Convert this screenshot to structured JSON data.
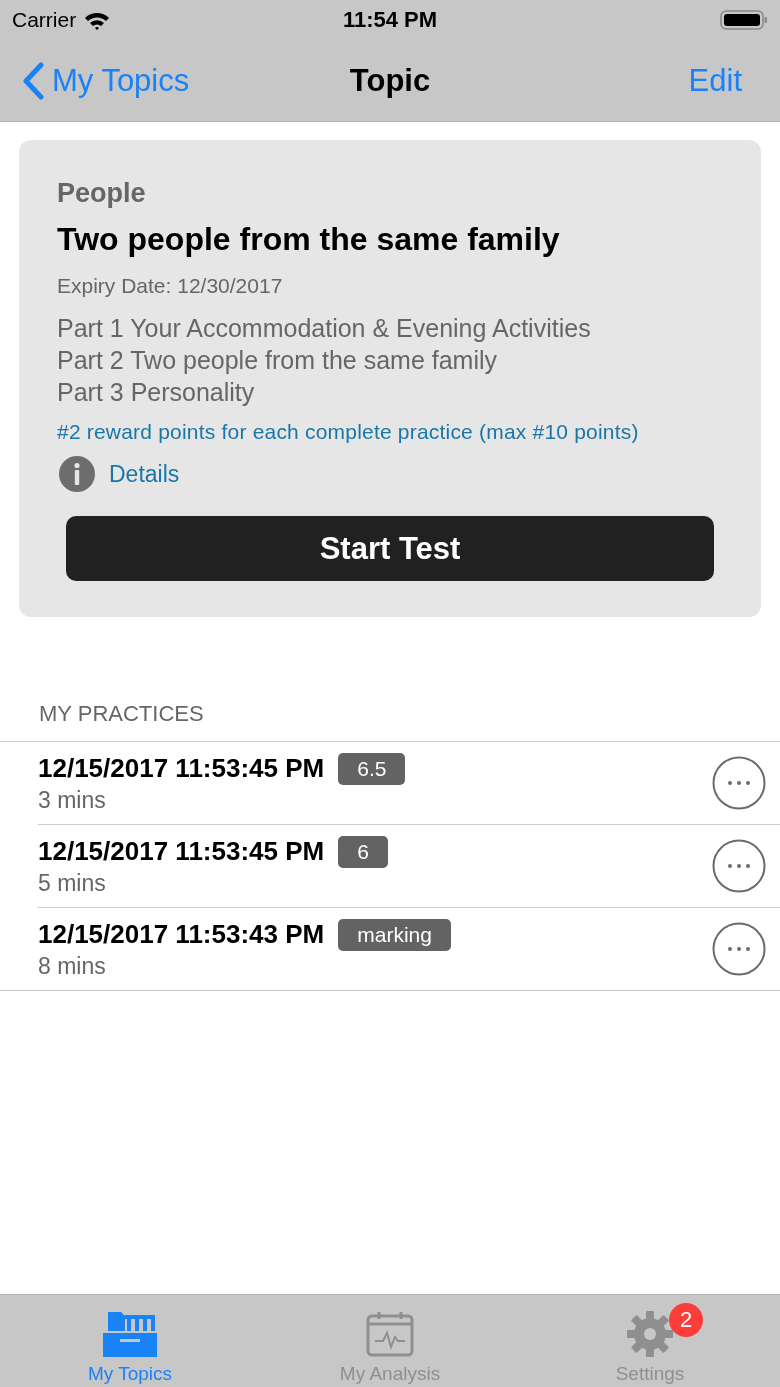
{
  "status_bar": {
    "carrier": "Carrier",
    "time": "11:54 PM"
  },
  "nav_bar": {
    "back": "My Topics",
    "title": "Topic",
    "action": "Edit"
  },
  "topic": {
    "category": "People",
    "title": "Two people from the same family",
    "expiry": "Expiry Date: 12/30/2017",
    "parts": [
      "Part 1 Your Accommodation & Evening Activities",
      "Part 2 Two people from the same family",
      "Part 3 Personality"
    ],
    "reward": "#2 reward points for each complete practice (max #10 points)",
    "details": "Details",
    "button": "Start Test"
  },
  "practices": {
    "header": "MY PRACTICES",
    "items": [
      {
        "datetime": "12/15/2017 11:53:45 PM",
        "score": "6.5",
        "duration": "3 mins"
      },
      {
        "datetime": "12/15/2017 11:53:45 PM",
        "score": "6",
        "duration": "5 mins"
      },
      {
        "datetime": "12/15/2017 11:53:43 PM",
        "score": "marking",
        "duration": "8 mins"
      }
    ]
  },
  "tab_bar": [
    {
      "kind": "topics",
      "label": "My Topics",
      "selected": true
    },
    {
      "kind": "analysis",
      "label": "My Analysis",
      "selected": false
    },
    {
      "kind": "settings",
      "label": "Settings",
      "selected": false,
      "badge": "2"
    }
  ]
}
